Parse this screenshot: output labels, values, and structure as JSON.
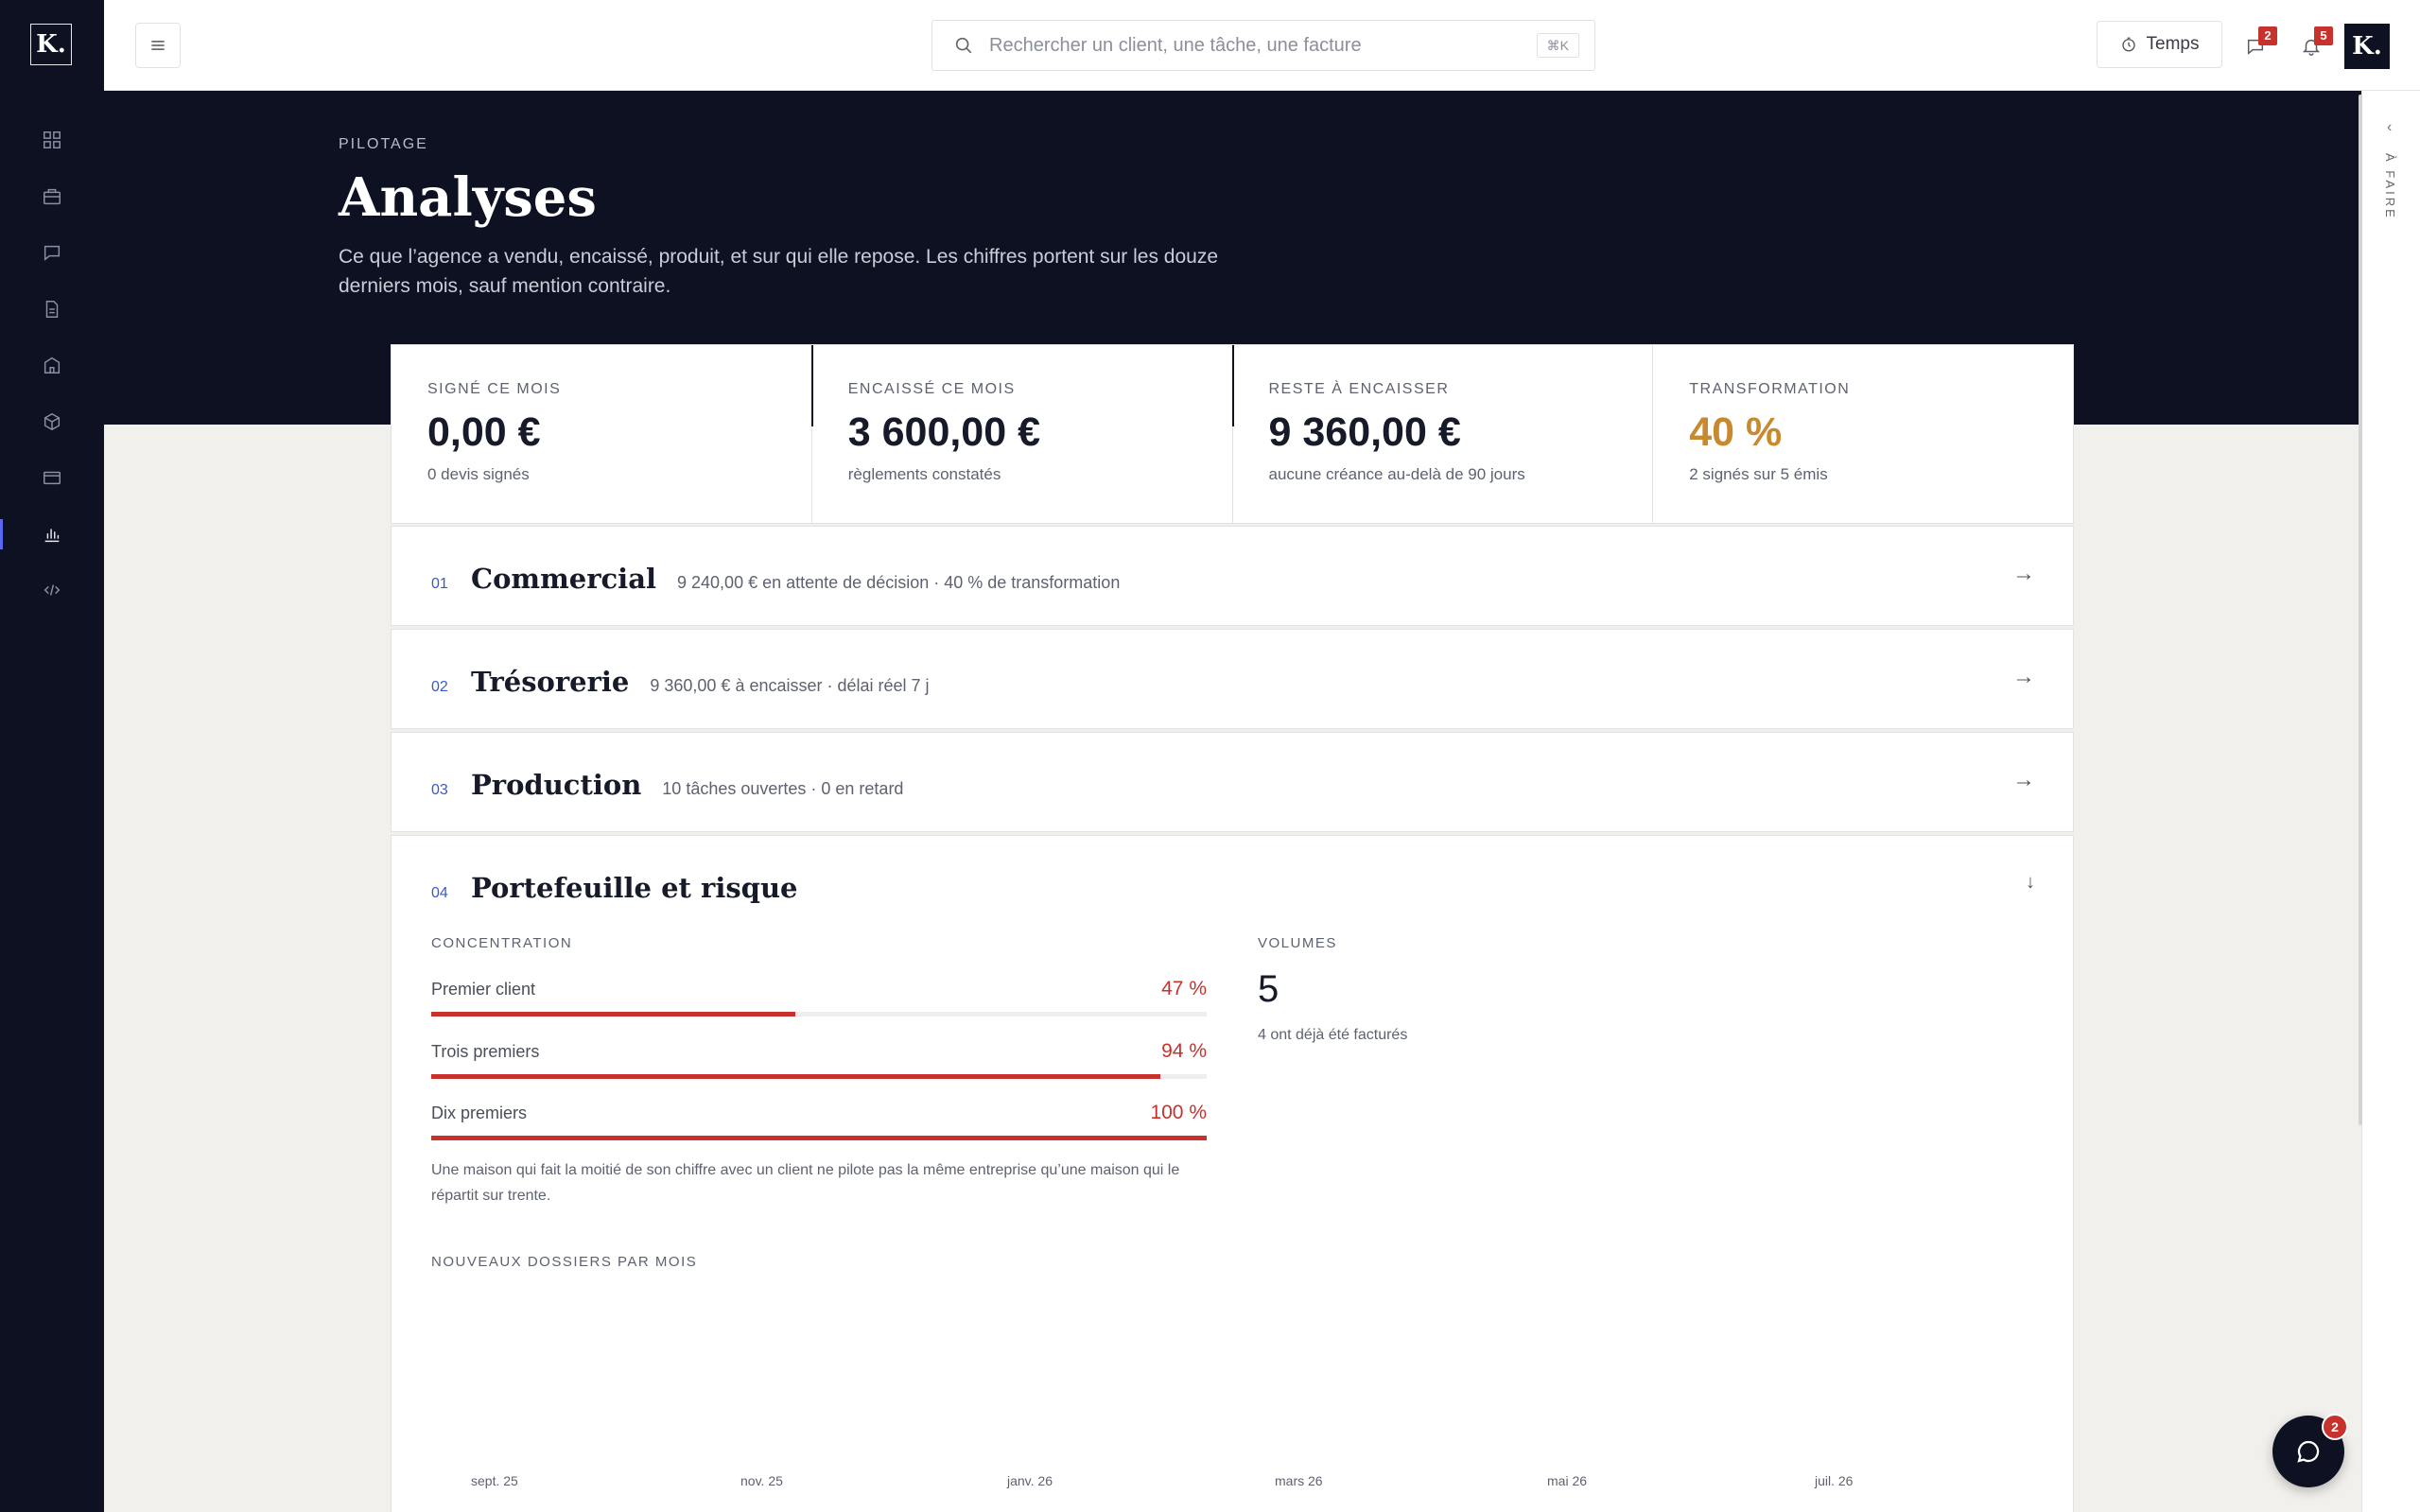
{
  "brand": {
    "logo_letter": "K",
    "logo_dot": "."
  },
  "search": {
    "placeholder": "Rechercher un client, une tâche, une facture",
    "shortcut": "⌘K"
  },
  "topbar": {
    "time_label": "Temps",
    "messages_badge": "2",
    "notifications_badge": "5",
    "avatar_letter": "K."
  },
  "sidebar": {
    "items": [
      {
        "icon": "dashboard-icon",
        "active": false
      },
      {
        "icon": "briefcase-icon",
        "active": false
      },
      {
        "icon": "message-icon",
        "active": false
      },
      {
        "icon": "document-icon",
        "active": false
      },
      {
        "icon": "building-icon",
        "active": false
      },
      {
        "icon": "cube-icon",
        "active": false
      },
      {
        "icon": "card-icon",
        "active": false
      },
      {
        "icon": "chart-icon",
        "active": true
      },
      {
        "icon": "code-icon",
        "active": false
      }
    ]
  },
  "rail": {
    "label": "À FAIRE"
  },
  "hero": {
    "eyebrow": "PILOTAGE",
    "title": "Analyses",
    "description": "Ce que l’agence a vendu, encaissé, produit, et sur qui elle repose. Les chiffres portent sur les douze derniers mois, sauf mention contraire."
  },
  "kpis": [
    {
      "label": "SIGNÉ CE MOIS",
      "value": "0,00 €",
      "sub": "0 devis signés"
    },
    {
      "label": "ENCAISSÉ CE MOIS",
      "value": "3 600,00 €",
      "sub": "règlements constatés"
    },
    {
      "label": "RESTE À ENCAISSER",
      "value": "9 360,00 €",
      "sub": "aucune créance au-delà de 90 jours"
    },
    {
      "label": "TRANSFORMATION",
      "value": "40 %",
      "sub": "2 signés sur 5 émis"
    }
  ],
  "sections": [
    {
      "num": "01",
      "title": "Commercial",
      "meta": "9 240,00 € en attente de décision · 40 % de transformation",
      "arrow": "→"
    },
    {
      "num": "02",
      "title": "Trésorerie",
      "meta": "9 360,00 € à encaisser · délai réel 7 j",
      "arrow": "→"
    },
    {
      "num": "03",
      "title": "Production",
      "meta": "10 tâches ouvertes · 0 en retard",
      "arrow": "→"
    },
    {
      "num": "04",
      "title": "Portefeuille et risque",
      "meta": "",
      "arrow": "↓"
    }
  ],
  "portfolio": {
    "concentration_label": "CONCENTRATION",
    "rows": [
      {
        "name": "Premier client",
        "pct": "47 %",
        "value": 0.47
      },
      {
        "name": "Trois premiers",
        "pct": "94 %",
        "value": 0.94
      },
      {
        "name": "Dix premiers",
        "pct": "100 %",
        "value": 1.0
      }
    ],
    "note": "Une maison qui fait la moitié de son chiffre avec un client ne pilote pas la même entreprise qu’une maison qui le répartit sur trente.",
    "volumes_label": "VOLUMES",
    "volumes_value": "5",
    "volumes_sub": "4 ont déjà été facturés",
    "monthly_label": "NOUVEAUX DOSSIERS PAR MOIS",
    "months": [
      "sept. 25",
      "nov. 25",
      "janv. 26",
      "mars 26",
      "mai 26",
      "juil. 26"
    ]
  },
  "chat": {
    "badge": "2"
  }
}
